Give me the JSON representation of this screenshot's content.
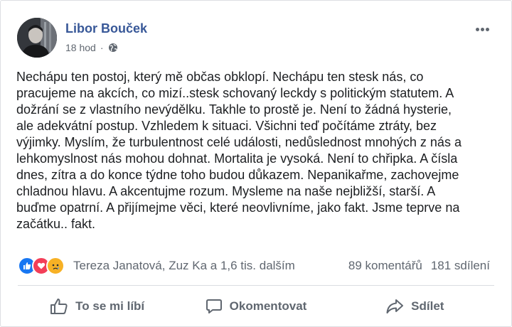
{
  "post": {
    "author": "Libor Bouček",
    "time": "18 hod",
    "separator": "·",
    "privacy_icon": "globe-icon",
    "more_icon": "more-options-icon",
    "text": "Nechápu ten postoj, který mě občas obklopí. Nechápu ten stesk nás, co\npracujeme na akcích, co mizí..stesk schovaný leckdy s politickým statutem. A\ndožrání se z vlastního nevýdělku. Takhle to prostě je. Není to žádná hysterie,\nale adekvátní postup. Vzhledem k situaci. Všichni teď počítáme ztráty, bez\nvýjimky. Myslím, že turbulentnost celé události, nedůslednost mnohých z nás a\nlehkomyslnost nás mohou dohnat. Mortalita je vysoká. Není to chřipka. A čísla\ndnes, zítra a do konce týdne toho budou důkazem. Nepanikařme, zachovejme\nchladnou hlavu. A akcentujme rozum. Mysleme na naše nejbližší, starší. A\nbuďme opatrní. A přijímejme věci, které neovlivníme, jako fakt. Jsme teprve na\nzačátku.. fakt."
  },
  "stats": {
    "reaction_icons": [
      "like-reaction-icon",
      "love-reaction-icon",
      "sad-reaction-icon"
    ],
    "names": "Tereza Janatová, Zuz Ka a 1,6 tis. dalším",
    "comments": "89 komentářů",
    "shares": "181 sdílení"
  },
  "actions": {
    "like": "To se mi líbí",
    "comment": "Okomentovat",
    "share": "Sdílet"
  },
  "colors": {
    "author": "#385898",
    "secondary": "#606770",
    "like": "#1877f2",
    "love": "#f33e58",
    "sad": "#f7b125"
  }
}
